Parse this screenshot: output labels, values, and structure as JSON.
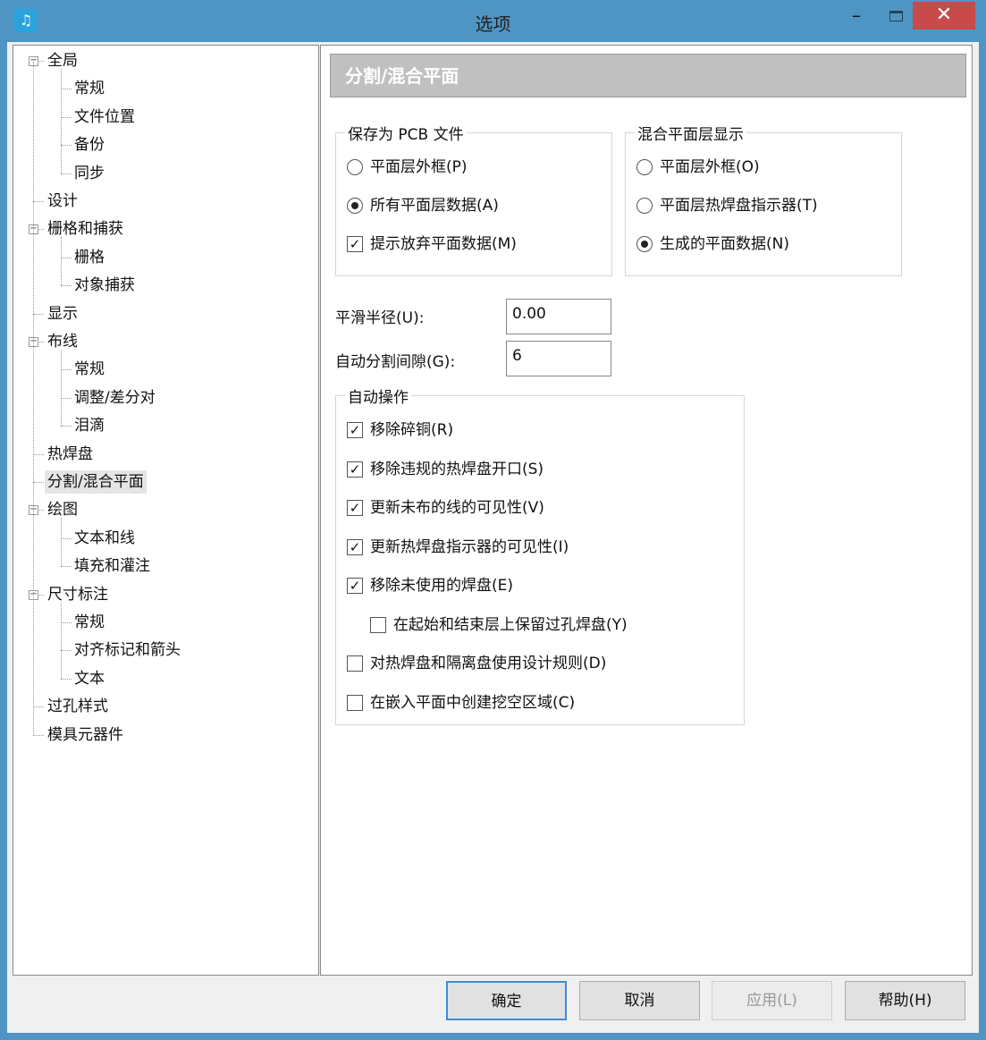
{
  "window": {
    "title": "选项",
    "icon": "app-icon",
    "minimize": "–",
    "close": "✕"
  },
  "tree": [
    {
      "label": "全局",
      "level": 0,
      "expanded": true
    },
    {
      "label": "常规",
      "level": 1
    },
    {
      "label": "文件位置",
      "level": 1
    },
    {
      "label": "备份",
      "level": 1
    },
    {
      "label": "同步",
      "level": 1
    },
    {
      "label": "设计",
      "level": 0
    },
    {
      "label": "栅格和捕获",
      "level": 0,
      "expanded": true
    },
    {
      "label": "栅格",
      "level": 1
    },
    {
      "label": "对象捕获",
      "level": 1
    },
    {
      "label": "显示",
      "level": 0
    },
    {
      "label": "布线",
      "level": 0,
      "expanded": true
    },
    {
      "label": "常规",
      "level": 1
    },
    {
      "label": "调整/差分对",
      "level": 1
    },
    {
      "label": "泪滴",
      "level": 1
    },
    {
      "label": "热焊盘",
      "level": 0
    },
    {
      "label": "分割/混合平面",
      "level": 0,
      "selected": true
    },
    {
      "label": "绘图",
      "level": 0,
      "expanded": true
    },
    {
      "label": "文本和线",
      "level": 1
    },
    {
      "label": "填充和灌注",
      "level": 1
    },
    {
      "label": "尺寸标注",
      "level": 0,
      "expanded": true
    },
    {
      "label": "常规",
      "level": 1
    },
    {
      "label": "对齐标记和箭头",
      "level": 1
    },
    {
      "label": "文本",
      "level": 1
    },
    {
      "label": "过孔样式",
      "level": 0
    },
    {
      "label": "模具元器件",
      "level": 0
    }
  ],
  "panel": {
    "title": "分割/混合平面",
    "save_group": {
      "label": "保存为 PCB 文件",
      "options": [
        {
          "label": "平面层外框(P)",
          "type": "radio",
          "checked": false
        },
        {
          "label": "所有平面层数据(A)",
          "type": "radio",
          "checked": true
        },
        {
          "label": "提示放弃平面数据(M)",
          "type": "checkbox",
          "checked": true
        }
      ]
    },
    "mixed_group": {
      "label": "混合平面层显示",
      "options": [
        {
          "label": "平面层外框(O)",
          "type": "radio",
          "checked": false
        },
        {
          "label": "平面层热焊盘指示器(T)",
          "type": "radio",
          "checked": false
        },
        {
          "label": "生成的平面数据(N)",
          "type": "radio",
          "checked": true
        }
      ]
    },
    "smooth_radius": {
      "label": "平滑半径(U):",
      "value": "0.00"
    },
    "auto_split_gap": {
      "label": "自动分割间隙(G):",
      "value": "6"
    },
    "auto_group": {
      "label": "自动操作",
      "options": [
        {
          "label": "移除碎铜(R)",
          "checked": true
        },
        {
          "label": "移除违规的热焊盘开口(S)",
          "checked": true
        },
        {
          "label": "更新未布的线的可见性(V)",
          "checked": true
        },
        {
          "label": "更新热焊盘指示器的可见性(I)",
          "checked": true
        },
        {
          "label": "移除未使用的焊盘(E)",
          "checked": true
        },
        {
          "label": "在起始和结束层上保留过孔焊盘(Y)",
          "checked": false,
          "indent": true
        },
        {
          "label": "对热焊盘和隔离盘使用设计规则(D)",
          "checked": false
        },
        {
          "label": "在嵌入平面中创建挖空区域(C)",
          "checked": false
        }
      ]
    }
  },
  "buttons": {
    "ok": "确定",
    "cancel": "取消",
    "apply": "应用(L)",
    "help": "帮助(H)"
  },
  "colors": {
    "titlebar": "#4f95c4",
    "close": "#c94a4a",
    "header": "#c0c0c0"
  }
}
